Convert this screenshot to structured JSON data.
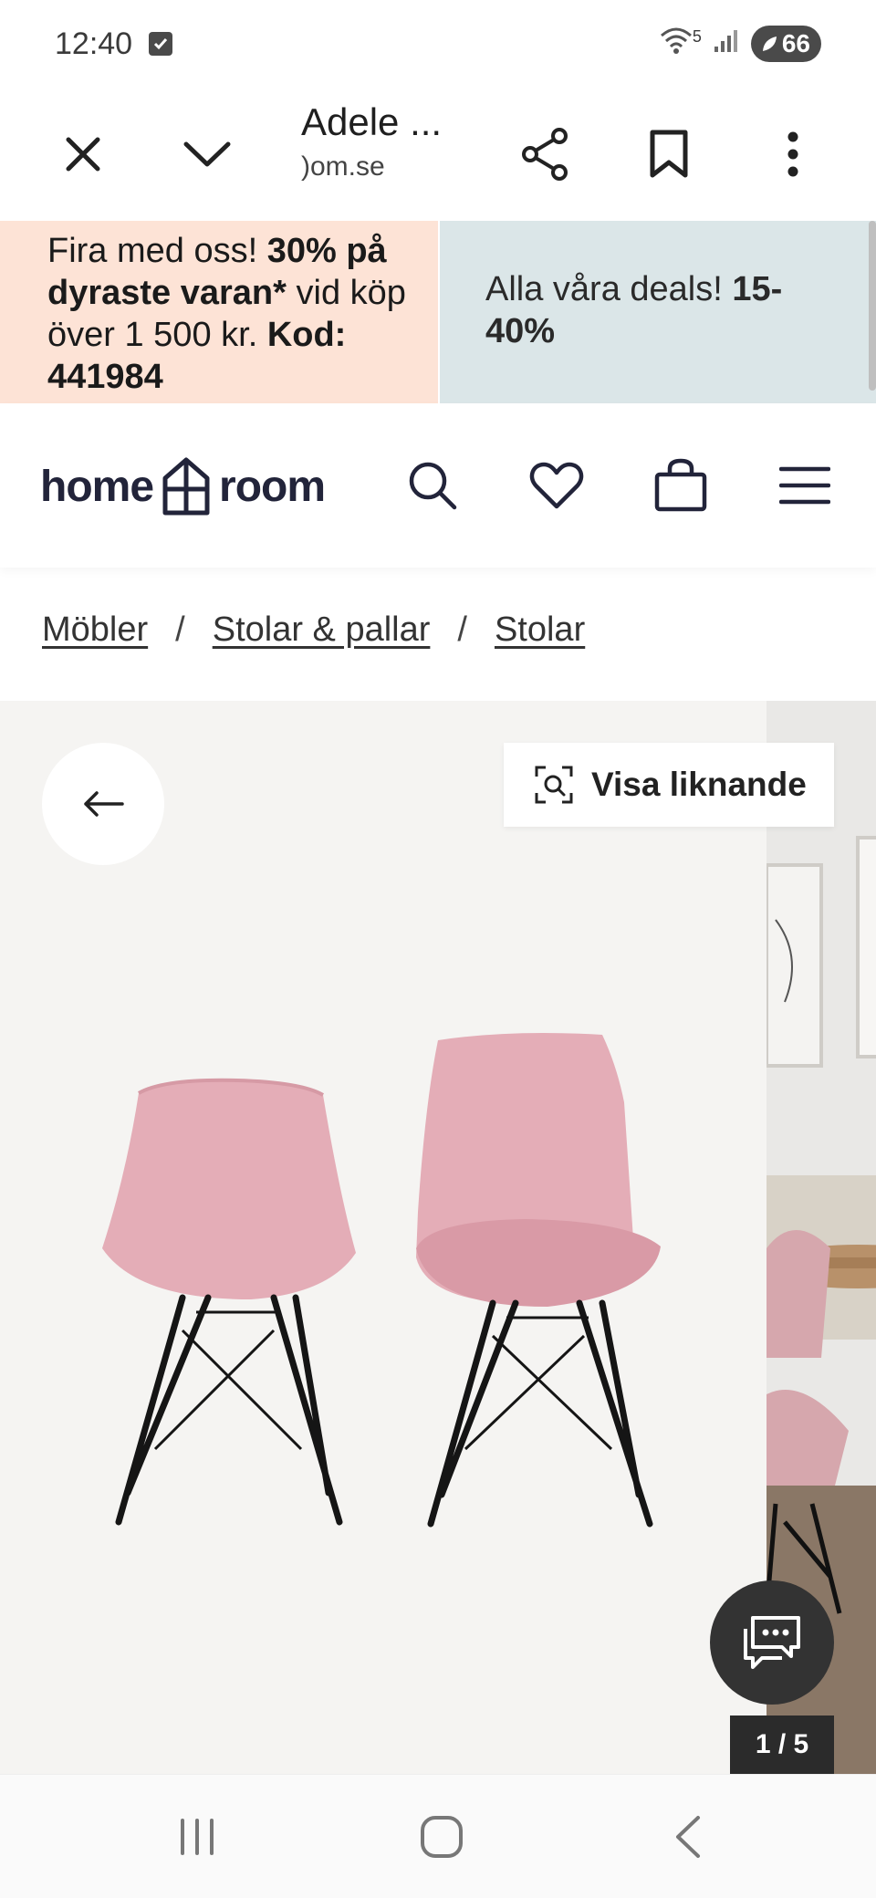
{
  "status": {
    "time": "12:40",
    "network_label": "5",
    "battery": "66"
  },
  "browser": {
    "title": "Adele ...",
    "url": ")om.se",
    "icons": [
      "close-icon",
      "chevron-down-icon",
      "share-icon",
      "bookmark-icon",
      "more-vert-icon"
    ]
  },
  "promo": {
    "left": {
      "p1": "Fira med oss! ",
      "b1": "30% på dyraste varan*",
      "p2": " vid köp över 1 500 kr. ",
      "b2": "Kod: 441984"
    },
    "right": {
      "p1": "Alla våra deals! ",
      "b1": "15-40%"
    },
    "colors": {
      "left_bg": "#fde3d6",
      "right_bg": "#dbe6e8"
    }
  },
  "header": {
    "logo_left": "home",
    "logo_right": "room",
    "icons": [
      "search-icon",
      "heart-icon",
      "bag-icon",
      "menu-icon"
    ]
  },
  "breadcrumb": {
    "items": [
      "Möbler",
      "Stolar & pallar",
      "Stolar"
    ],
    "separator": "/"
  },
  "gallery": {
    "similar_label": "Visa liknande",
    "counter": "1 / 5",
    "chair_color": "#e8b5bd"
  },
  "nav": {
    "icons": [
      "recents-icon",
      "home-icon",
      "back-icon"
    ]
  }
}
